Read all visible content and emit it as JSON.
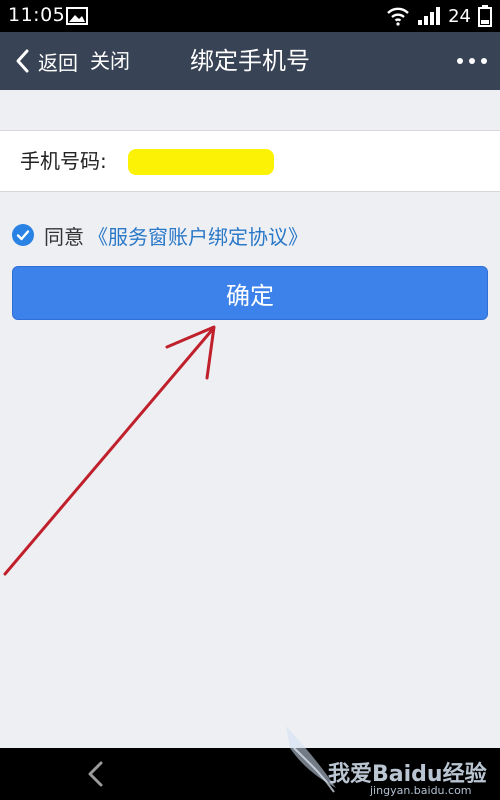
{
  "status_bar": {
    "time": "11:05",
    "battery_level": "24",
    "icons": [
      "image-icon",
      "wifi-icon",
      "signal-icon",
      "battery-icon"
    ]
  },
  "nav": {
    "back_label": "返回",
    "close_label": "关闭",
    "title": "绑定手机号",
    "more_icon": "more-dots-icon"
  },
  "form": {
    "phone_label": "手机号码:",
    "phone_value": ""
  },
  "agreement": {
    "checked": true,
    "agree_text": "同意",
    "link_text": "《服务窗账户绑定协议》"
  },
  "confirm_button": {
    "label": "确定"
  },
  "colors": {
    "nav_bg": "#394356",
    "button_bg": "#3d82ea",
    "link": "#2a78c8",
    "highlight": "#fbf205",
    "annotation": "#c0202c"
  },
  "watermark": {
    "text": "我爱Baidu经验",
    "url": "jingyan.baidu.com"
  }
}
